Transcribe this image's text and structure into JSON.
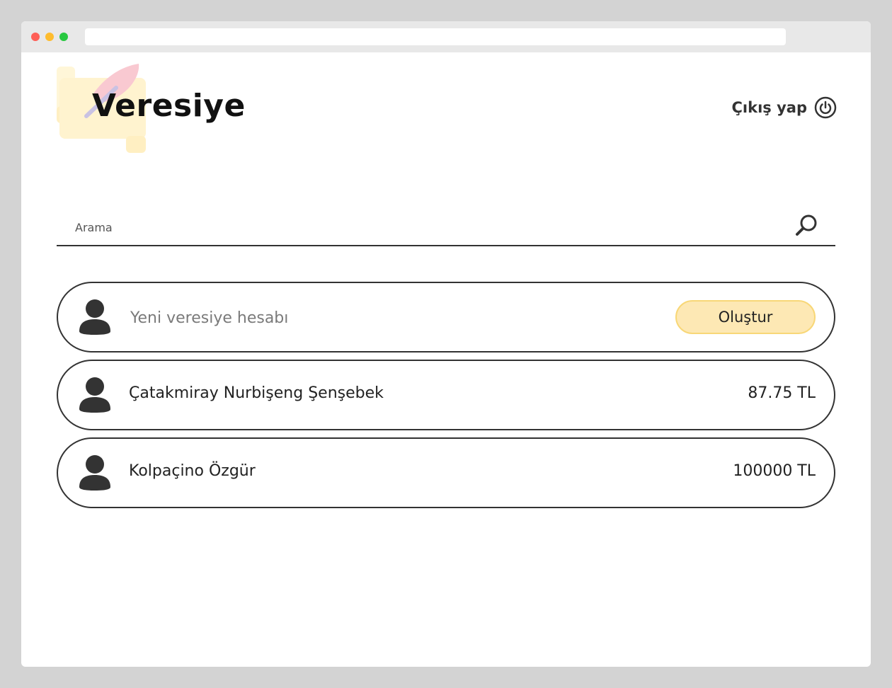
{
  "app": {
    "title": "Veresiye",
    "logout_label": "Çıkış yap"
  },
  "icons": {
    "logo": "scroll-quill-icon",
    "logout": "power-icon",
    "search": "magnifier-icon",
    "avatar": "user-avatar-icon"
  },
  "colors": {
    "accent": "#fde8b4",
    "accent_border": "#f8d777",
    "text": "#222222",
    "border": "#333333"
  },
  "search": {
    "placeholder": "Arama"
  },
  "new_account": {
    "placeholder": "Yeni veresiye hesabı",
    "create_label": "Oluştur"
  },
  "accounts": [
    {
      "name": "Çatakmiray Nurbişeng Şenşebek",
      "amount": "87.75 TL"
    },
    {
      "name": "Kolpaçino Özgür",
      "amount": "100000 TL"
    }
  ]
}
